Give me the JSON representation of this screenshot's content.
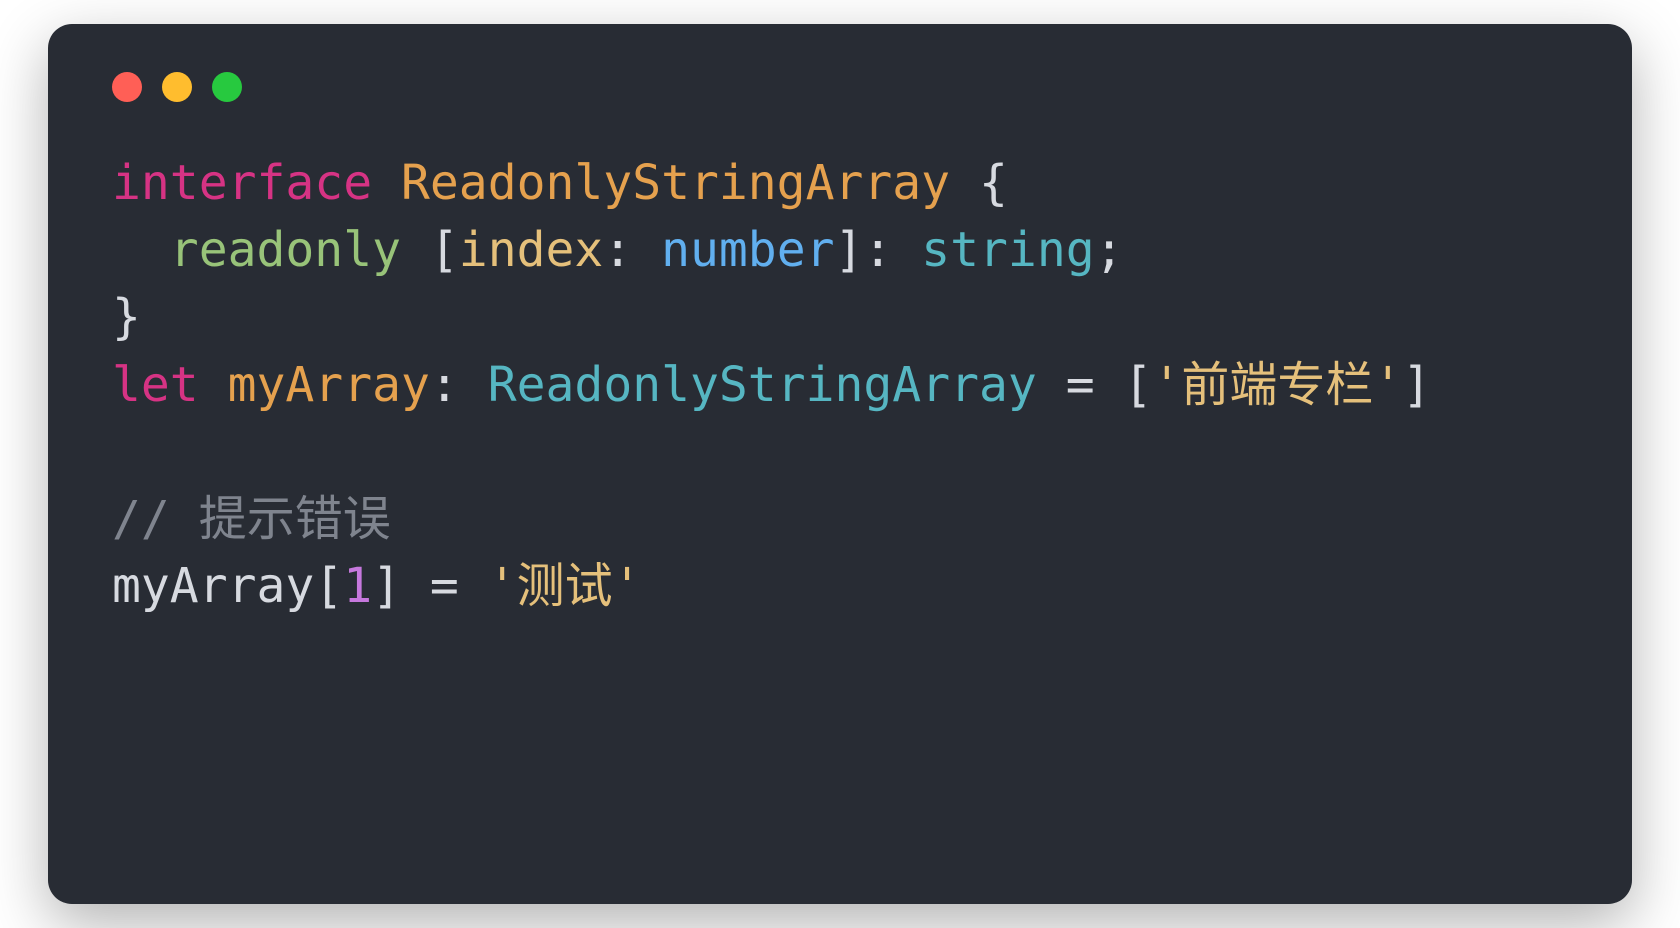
{
  "window": {
    "traffic_light_colors": {
      "red": "#ff5f56",
      "yellow": "#ffbd2e",
      "green": "#27c93f"
    }
  },
  "code": {
    "line1": {
      "kw_interface": "interface",
      "space1": " ",
      "classname": "ReadonlyStringArray",
      "space2": " ",
      "brace_open": "{"
    },
    "line2": {
      "indent": "  ",
      "kw_readonly": "readonly",
      "space1": " ",
      "bracket_open": "[",
      "param": "index",
      "colon1": ":",
      "space2": " ",
      "type_number": "number",
      "bracket_close": "]",
      "colon2": ":",
      "space3": " ",
      "type_string": "string",
      "semicolon": ";"
    },
    "line3": {
      "brace_close": "}"
    },
    "line4": {
      "kw_let": "let",
      "space1": " ",
      "ident": "myArray",
      "colon": ":",
      "space2": " ",
      "type": "ReadonlyStringArray",
      "space3": " ",
      "equals": "=",
      "space4": " ",
      "bracket_open": "[",
      "quote_open": "'",
      "string_val": "前端专栏",
      "quote_close": "'",
      "bracket_close": "]"
    },
    "line5": "",
    "line6": {
      "comment": "// 提示错误"
    },
    "line7": {
      "ident": "myArray",
      "bracket_open": "[",
      "index": "1",
      "bracket_close": "]",
      "space1": " ",
      "equals": "=",
      "space2": " ",
      "quote_open": "'",
      "string_val": "测试",
      "quote_close": "'"
    }
  }
}
